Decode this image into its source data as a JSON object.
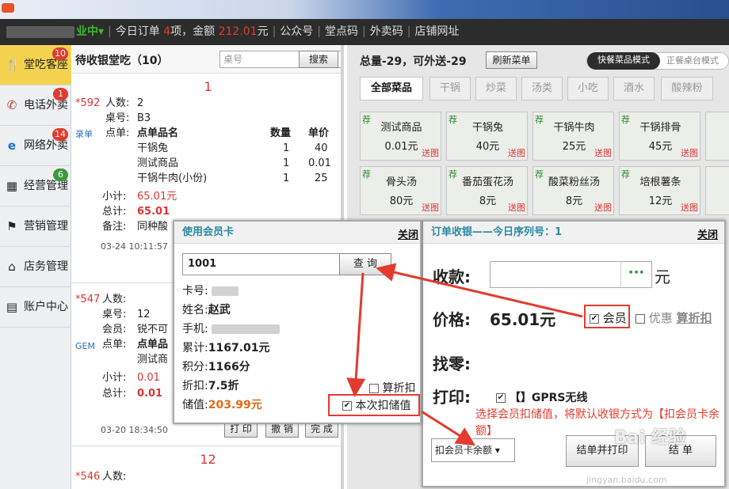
{
  "topbar": {
    "status": "业中▾",
    "today_order_prefix": "今日订单",
    "today_order_count": "4",
    "today_order_mid": "项，金额",
    "today_order_amount": "212.01",
    "today_order_suffix": "元",
    "links": [
      "公众号",
      "堂点码",
      "外卖码",
      "店铺网址"
    ]
  },
  "sidebar": {
    "items": [
      {
        "label": "堂吃客座",
        "icon": "fork-icon",
        "badge": "10"
      },
      {
        "label": "电话外卖",
        "icon": "phone-icon",
        "badge": "1"
      },
      {
        "label": "网络外卖",
        "icon": "ie-icon",
        "badge": "14"
      },
      {
        "label": "经营管理",
        "icon": "grid-icon",
        "badge": "6"
      },
      {
        "label": "营销管理",
        "icon": "flag-icon",
        "badge": ""
      },
      {
        "label": "店务管理",
        "icon": "home-icon",
        "badge": ""
      },
      {
        "label": "账户中心",
        "icon": "card-icon",
        "badge": ""
      }
    ]
  },
  "orders": {
    "title": "待收银堂吃（10）",
    "table_placeholder": "桌号",
    "search_label": "搜索",
    "order1": {
      "number": "1",
      "code": "*592",
      "people_label": "人数:",
      "people": "2",
      "table_label": "桌号:",
      "table": "B3",
      "tag": "录单",
      "items_label": "点单:",
      "col_name": "点单品名",
      "col_qty": "数量",
      "col_price": "单价",
      "items": [
        {
          "name": "干锅兔",
          "qty": "1",
          "price": "40"
        },
        {
          "name": "测试商品",
          "qty": "1",
          "price": "0.01"
        },
        {
          "name": "干锅牛肉(小份)",
          "qty": "1",
          "price": "25"
        }
      ],
      "subtotal_label": "小计:",
      "subtotal": "65.01元",
      "total_label": "总计:",
      "total": "65.01",
      "note_label": "备注:",
      "note": "同种酸",
      "time": "03-24 10:11:57"
    },
    "order2": {
      "code": "*547",
      "people_label": "人数:",
      "table_label": "桌号:",
      "table": "12",
      "member_label": "会员:",
      "member": "锐不可",
      "tag": "GEM",
      "items_label": "点单:",
      "col_name": "点单品",
      "item1": "测试商",
      "subtotal_label": "小计:",
      "subtotal": "0.01",
      "total_label": "总计:",
      "total": "0.01",
      "time": "03-20 18:34:50",
      "btn_print": "打 印",
      "btn_cancel": "撤 销",
      "btn_done": "完 成"
    },
    "order3": {
      "number": "12",
      "code": "*546",
      "people_label": "人数:"
    }
  },
  "menu": {
    "title": "总量-29，可外送-29",
    "refresh_label": "刷新菜单",
    "mode_on": "快餐菜品模式",
    "mode_off": "正餐桌台模式",
    "categories": [
      "全部菜品",
      "干锅",
      "炒菜",
      "汤类",
      "小吃",
      "酒水",
      "酸辣粉"
    ],
    "rec_tag": "荐",
    "send_tag": "送图",
    "dishes": [
      {
        "name": "测试商品",
        "price": "0.01元"
      },
      {
        "name": "干锅兔",
        "price": "40元"
      },
      {
        "name": "干锅牛肉",
        "price": "25元"
      },
      {
        "name": "干锅排骨",
        "price": "45元"
      },
      {
        "name": "骨头汤",
        "price": "80元"
      },
      {
        "name": "番茄蛋花汤",
        "price": "8元"
      },
      {
        "name": "酸菜粉丝汤",
        "price": "8元"
      },
      {
        "name": "培根薯条",
        "price": "12元"
      }
    ]
  },
  "member_dialog": {
    "title": "使用会员卡",
    "close": "关闭",
    "card_input": "1001",
    "query_label": "查 询",
    "card_no_label": "卡号:",
    "name_label": "姓名:",
    "name": "赵武",
    "phone_label": "手机:",
    "total_label": "累计:",
    "total": "1167.01元",
    "points_label": "积分:",
    "points": "1166分",
    "discount_label": "折扣:",
    "discount": "7.5折",
    "balance_label": "储值:",
    "balance": "203.99元",
    "calc_discount": "算折扣",
    "use_balance": "本次扣储值"
  },
  "cashier": {
    "title": "订单收银——今日序列号：1",
    "close": "关闭",
    "receive_label": "收款:",
    "more_btn": "···",
    "yuan": "元",
    "price_label": "价格:",
    "price": "65.01元",
    "member_label": "会员",
    "promo_label": "优惠",
    "calc_discount": "算折扣",
    "change_label": "找零:",
    "print_label": "打印:",
    "print_option": "【】GPRS无线",
    "pay_method": "扣会员卡余额",
    "btn_print_checkout": "结单并打印",
    "btn_checkout": "结 单",
    "annotation": "选择会员扣储值，将默认收银方式为【扣会员卡余额】"
  },
  "watermark": {
    "text": "Bai 经验",
    "url": "jingyan.baidu.com"
  },
  "colors": {
    "accent_red": "#e23b2e",
    "teal_title": "#2a8aa3",
    "sidebar_active": "#f3d24f",
    "topbar_bg": "#2c2c2c"
  }
}
